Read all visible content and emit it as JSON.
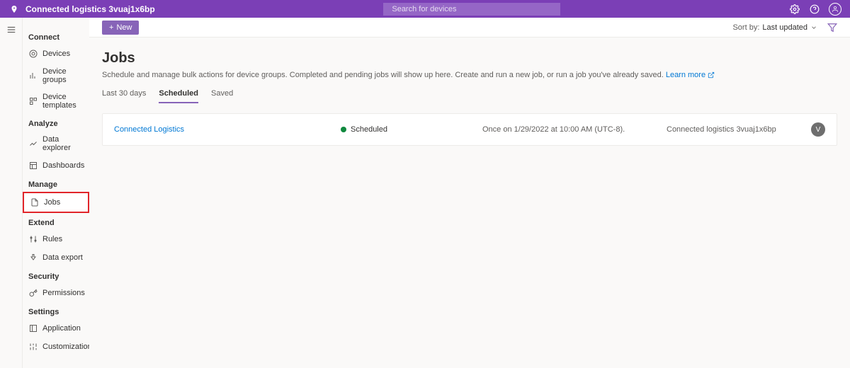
{
  "header": {
    "title": "Connected logistics 3vuaj1x6bp",
    "search_placeholder": "Search for devices"
  },
  "sidebar": {
    "sections": [
      {
        "label": "Connect",
        "items": [
          {
            "label": "Devices",
            "name": "sidebar-item-devices"
          },
          {
            "label": "Device groups",
            "name": "sidebar-item-device-groups"
          },
          {
            "label": "Device templates",
            "name": "sidebar-item-device-templates"
          }
        ]
      },
      {
        "label": "Analyze",
        "items": [
          {
            "label": "Data explorer",
            "name": "sidebar-item-data-explorer"
          },
          {
            "label": "Dashboards",
            "name": "sidebar-item-dashboards"
          }
        ]
      },
      {
        "label": "Manage",
        "items": [
          {
            "label": "Jobs",
            "name": "sidebar-item-jobs",
            "active": true,
            "highlighted": true
          }
        ]
      },
      {
        "label": "Extend",
        "items": [
          {
            "label": "Rules",
            "name": "sidebar-item-rules"
          },
          {
            "label": "Data export",
            "name": "sidebar-item-data-export"
          }
        ]
      },
      {
        "label": "Security",
        "items": [
          {
            "label": "Permissions",
            "name": "sidebar-item-permissions"
          }
        ]
      },
      {
        "label": "Settings",
        "items": [
          {
            "label": "Application",
            "name": "sidebar-item-application"
          },
          {
            "label": "Customization",
            "name": "sidebar-item-customization"
          }
        ]
      }
    ]
  },
  "toolbar": {
    "new_label": "New",
    "sort_label": "Sort by:",
    "sort_value": "Last updated"
  },
  "page": {
    "title": "Jobs",
    "description": "Schedule and manage bulk actions for device groups. Completed and pending jobs will show up here. Create and run a new job, or run a job you've already saved.",
    "learn_more": "Learn more"
  },
  "tabs": [
    {
      "label": "Last 30 days"
    },
    {
      "label": "Scheduled",
      "active": true
    },
    {
      "label": "Saved"
    }
  ],
  "jobs": [
    {
      "name": "Connected Logistics",
      "status": "Scheduled",
      "schedule": "Once on 1/29/2022 at 10:00 AM (UTC-8).",
      "target": "Connected logistics 3vuaj1x6bp",
      "avatar": "V"
    }
  ]
}
